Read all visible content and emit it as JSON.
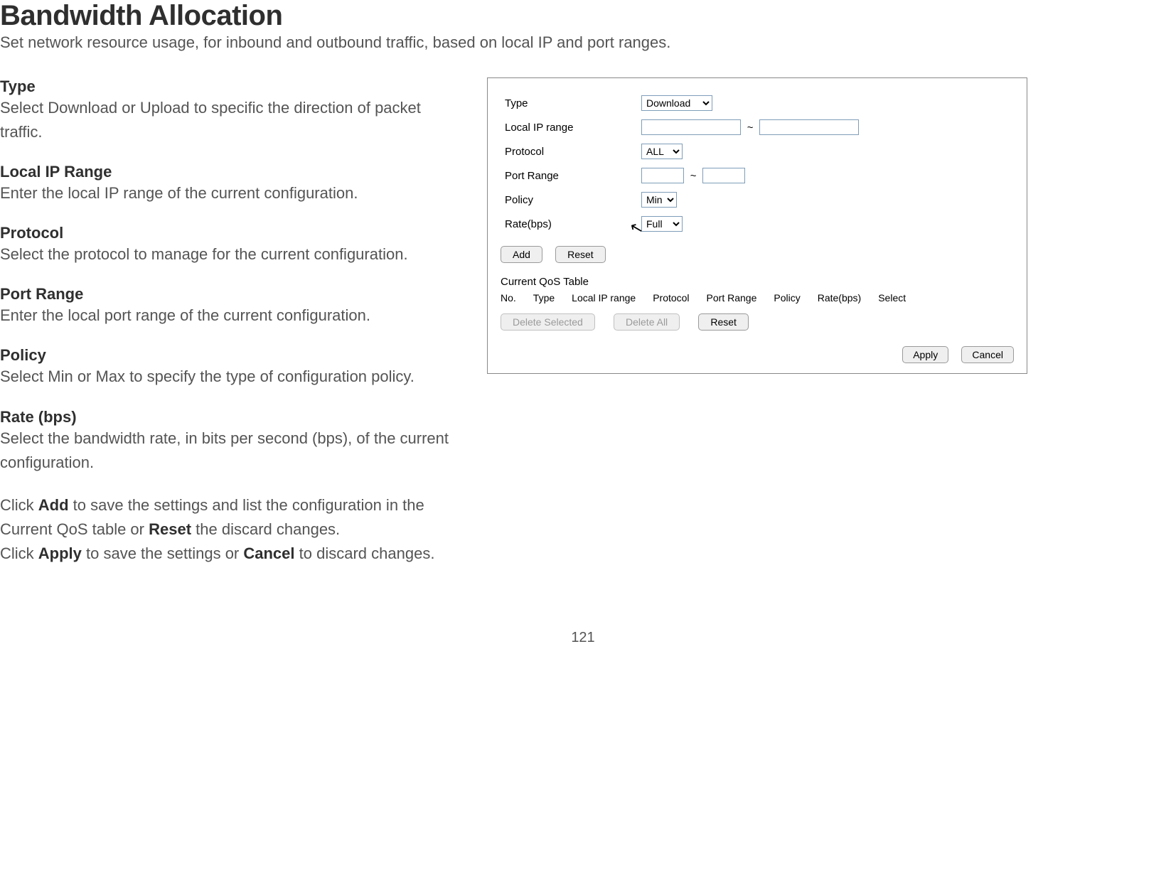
{
  "page": {
    "title": "Bandwidth Allocation",
    "subtitle": "Set network resource usage, for inbound and outbound traffic, based on local IP and port ranges.",
    "page_number": "121"
  },
  "fields": {
    "type": {
      "label": "Type",
      "desc": "Select Download or Upload to specific the direction of packet traffic."
    },
    "local_ip": {
      "label": "Local IP Range",
      "desc": "Enter the local IP range of the current configuration."
    },
    "protocol": {
      "label": "Protocol",
      "desc": "Select the protocol to manage for the current configuration."
    },
    "port_range": {
      "label": "Port Range",
      "desc": "Enter the local port range of the current configuration."
    },
    "policy": {
      "label": "Policy",
      "desc": "Select Min or Max to specify the type of configuration policy."
    },
    "rate": {
      "label": "Rate (bps)",
      "desc": "Select the bandwidth rate, in bits per second (bps), of the current configuration."
    }
  },
  "footer": {
    "click_word": "Click ",
    "add_bold": "Add",
    "line1_after_add": " to save the settings and list the configuration in the",
    "line2_before_reset": "Current QoS table or ",
    "reset_bold": "Reset",
    "line2_after_reset": " the discard changes.",
    "line3_before_apply": "Click ",
    "apply_bold": "Apply",
    "line3_middle": " to save the settings or ",
    "cancel_bold": "Cancel",
    "line3_after_cancel": " to discard changes."
  },
  "panel": {
    "labels": {
      "type": "Type",
      "local_ip": "Local IP range",
      "protocol": "Protocol",
      "port_range": "Port Range",
      "policy": "Policy",
      "rate": "Rate(bps)"
    },
    "values": {
      "type": "Download",
      "ip_from": "",
      "ip_to": "",
      "protocol": "ALL",
      "port_from": "",
      "port_to": "",
      "policy": "Min",
      "rate": "Full",
      "tilde": "~"
    },
    "buttons": {
      "add": "Add",
      "reset": "Reset",
      "delete_selected": "Delete Selected",
      "delete_all": "Delete All",
      "apply": "Apply",
      "cancel": "Cancel"
    },
    "qos": {
      "title": "Current QoS Table",
      "headers": {
        "no": "No.",
        "type": "Type",
        "local_ip": "Local IP range",
        "protocol": "Protocol",
        "port_range": "Port Range",
        "policy": "Policy",
        "rate": "Rate(bps)",
        "select": "Select"
      }
    }
  }
}
